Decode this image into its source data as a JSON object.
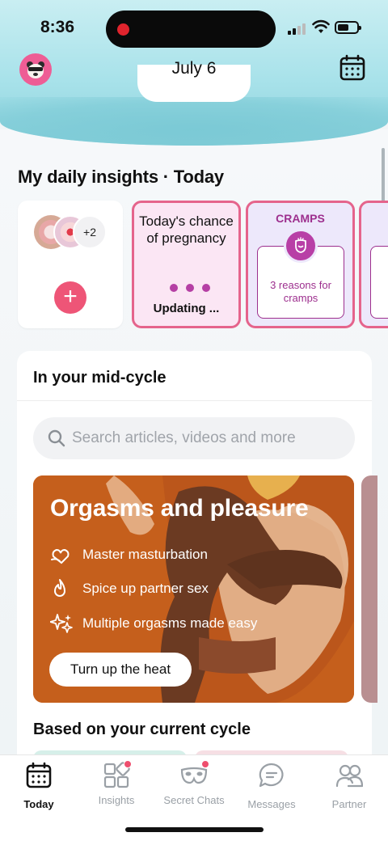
{
  "status": {
    "time": "8:36"
  },
  "header": {
    "date": "July 6"
  },
  "insights": {
    "title": "My daily insights · Today",
    "add_card": {
      "more_count": "+2"
    },
    "pregnancy_card": {
      "title": "Today's chance of pregnancy",
      "status": "Updating ..."
    },
    "cramps_card": {
      "label": "CRAMPS",
      "text": "3 reasons for cramps"
    }
  },
  "panel": {
    "title": "In your mid-cycle",
    "search_placeholder": "Search articles, videos and more",
    "feature": {
      "title": "Orgasms and pleasure",
      "items": [
        {
          "icon": "hand-heart-icon",
          "text": "Master masturbation"
        },
        {
          "icon": "flame-icon",
          "text": "Spice up partner sex"
        },
        {
          "icon": "sparkle-icon",
          "text": "Multiple orgasms made easy"
        }
      ],
      "cta": "Turn up the heat"
    },
    "based_title": "Based on your current cycle"
  },
  "tabs": [
    {
      "label": "Today",
      "icon": "calendar-icon",
      "active": true,
      "badge": false
    },
    {
      "label": "Insights",
      "icon": "grid-icon",
      "active": false,
      "badge": true
    },
    {
      "label": "Secret Chats",
      "icon": "mask-icon",
      "active": false,
      "badge": true
    },
    {
      "label": "Messages",
      "icon": "chat-icon",
      "active": false,
      "badge": false
    },
    {
      "label": "Partner",
      "icon": "partner-icon",
      "active": false,
      "badge": false
    }
  ],
  "colors": {
    "accent_pink": "#ee5577",
    "purple": "#9d2f8e",
    "feature_bg": "#c2611f"
  }
}
